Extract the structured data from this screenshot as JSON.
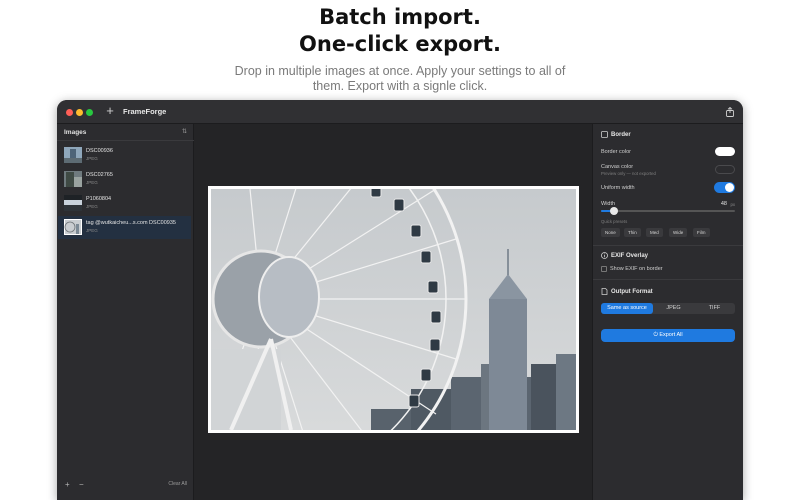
{
  "hero": {
    "title_line1": "Batch import.",
    "title_line2": "One-click export.",
    "subtitle_line1": "Drop in multiple images at once. Apply your settings to all of",
    "subtitle_line2": "them. Export with a signle click."
  },
  "app": {
    "title": "FrameForge",
    "add_icon": "plus-icon",
    "share_icon": "share-icon"
  },
  "sidebar": {
    "header": "Images",
    "sort_icon": "sort-icon",
    "items": [
      {
        "name": "DSC00936",
        "type": "JPEG"
      },
      {
        "name": "DSC02765",
        "type": "JPEG"
      },
      {
        "name": "P1060804",
        "type": "JPEG"
      },
      {
        "name": "tag @wutkaicheu...s.com DSC00935",
        "type": "JPEG",
        "selected": true
      }
    ],
    "add_label": "+",
    "remove_label": "−",
    "clear_all": "Clear All"
  },
  "inspector": {
    "border": {
      "title": "Border",
      "border_color_label": "Border color",
      "border_color": "#ffffff",
      "canvas_color_label": "Canvas color",
      "canvas_color_hint": "Preview only — not exported",
      "canvas_color": "#2c2c2f",
      "uniform_width_label": "Uniform width",
      "uniform_width_on": true,
      "width_label": "Width",
      "width_value": "48",
      "width_unit": "px",
      "width_fraction": 0.1,
      "quick_presets_label": "Quick presets",
      "presets": [
        "None",
        "Thin",
        "Med",
        "Wide",
        "Film"
      ]
    },
    "exif": {
      "title": "EXIF Overlay",
      "show_exif_label": "Show EXIF on border",
      "show_exif_checked": false
    },
    "output": {
      "title": "Output Format",
      "options": [
        "Same as source",
        "JPEG",
        "TIFF"
      ],
      "selected": "Same as source"
    },
    "export_label": "Export All",
    "accent": "#1f7ae0"
  }
}
